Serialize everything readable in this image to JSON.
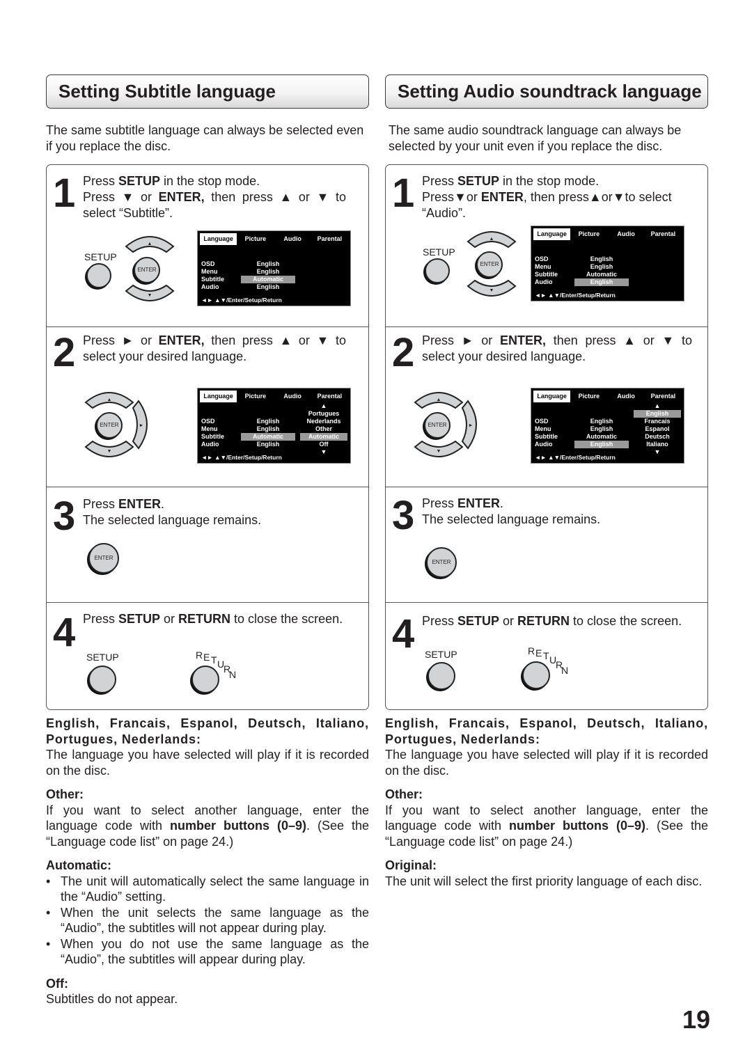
{
  "page_number": "19",
  "osd": {
    "tabs": [
      "Language",
      "Picture",
      "Audio",
      "Parental"
    ],
    "rows": [
      "OSD",
      "Menu",
      "Subtitle",
      "Audio"
    ],
    "footer": "◄► ▲▼/Enter/Setup/Return",
    "up_arrow": "▲",
    "down_arrow": "▼"
  },
  "buttons": {
    "setup": "SETUP",
    "enter": "ENTER",
    "return": "RETURN",
    "up": "▲",
    "down": "▼",
    "right": "►"
  },
  "subtitle": {
    "title": "Setting Subtitle language",
    "intro": "The same subtitle language can always be selected even if you replace the disc.",
    "steps": [
      {
        "num": "1",
        "lines": [
          "Press SETUP in the stop mode.",
          "Press ▼ or ENTER, then press ▲ or ▼ to select “Subtitle”."
        ],
        "menu": {
          "values": [
            "English",
            "English",
            "Automatic",
            "English"
          ],
          "highlight_row": 2
        }
      },
      {
        "num": "2",
        "text": "Press ► or ENTER, then press ▲ or ▼ to select your desired language.",
        "menu": {
          "values": [
            "English",
            "English",
            "Automatic",
            "English"
          ],
          "highlight_row": 2,
          "options": [
            "Portugues",
            "Nederlands",
            "Other",
            "Automatic",
            "Off"
          ],
          "highlight_option": "Automatic"
        }
      },
      {
        "num": "3",
        "lines": [
          "Press ENTER.",
          "The selected language remains."
        ]
      },
      {
        "num": "4",
        "text": "Press SETUP or RETURN to close the screen."
      }
    ],
    "notes": {
      "languages_head": "English, Francais, Espanol, Deutsch, Italiano, Portugues, Nederlands:",
      "languages_body": "The language you have selected will play if it is recorded on the disc.",
      "other_head": "Other:",
      "other_body_pre": "If you want to select another language, enter the language code with ",
      "other_body_bold": "number buttons (0–9)",
      "other_body_post": ". (See the “Language code list” on page 24.)",
      "automatic_head": "Automatic:",
      "automatic_bullets": [
        "The unit will automatically select the same language in the “Audio” setting.",
        "When the unit selects the same language as the “Audio”, the subtitles will not appear during play.",
        "When you do not use the same language as the “Audio”, the subtitles will appear during play."
      ],
      "off_head": "Off:",
      "off_body": "Subtitles do not appear."
    }
  },
  "audio": {
    "title": "Setting Audio soundtrack language",
    "intro": "The same audio soundtrack language can always be selected by your unit even if you replace the disc.",
    "steps": [
      {
        "num": "1",
        "lines": [
          "Press SETUP in the stop mode.",
          "Press ▼ or ENTER, then press ▲ or ▼ to select “Audio”."
        ],
        "menu": {
          "values": [
            "English",
            "English",
            "Automatic",
            "English"
          ],
          "highlight_row": 3
        }
      },
      {
        "num": "2",
        "text": "Press ► or ENTER, then press ▲ or ▼ to select your desired language.",
        "menu": {
          "values": [
            "English",
            "English",
            "Automatic",
            "English"
          ],
          "highlight_row": 3,
          "options": [
            "English",
            "Francais",
            "Espanol",
            "Deutsch",
            "Italiano"
          ],
          "highlight_option": "English"
        }
      },
      {
        "num": "3",
        "lines": [
          "Press ENTER.",
          "The selected language remains."
        ]
      },
      {
        "num": "4",
        "text": "Press SETUP or RETURN to close the screen."
      }
    ],
    "notes": {
      "languages_head": "English, Francais, Espanol, Deutsch, Italiano, Portugues, Nederlands:",
      "languages_body": "The language you have selected will play if it is recorded on the disc.",
      "other_head": "Other:",
      "other_body_pre": "If you want to select another language, enter the language code with ",
      "other_body_bold": "number buttons (0–9)",
      "other_body_post": ". (See the “Language code list” on page 24.)",
      "original_head": "Original:",
      "original_body": "The unit will select the first priority language of each disc."
    }
  }
}
